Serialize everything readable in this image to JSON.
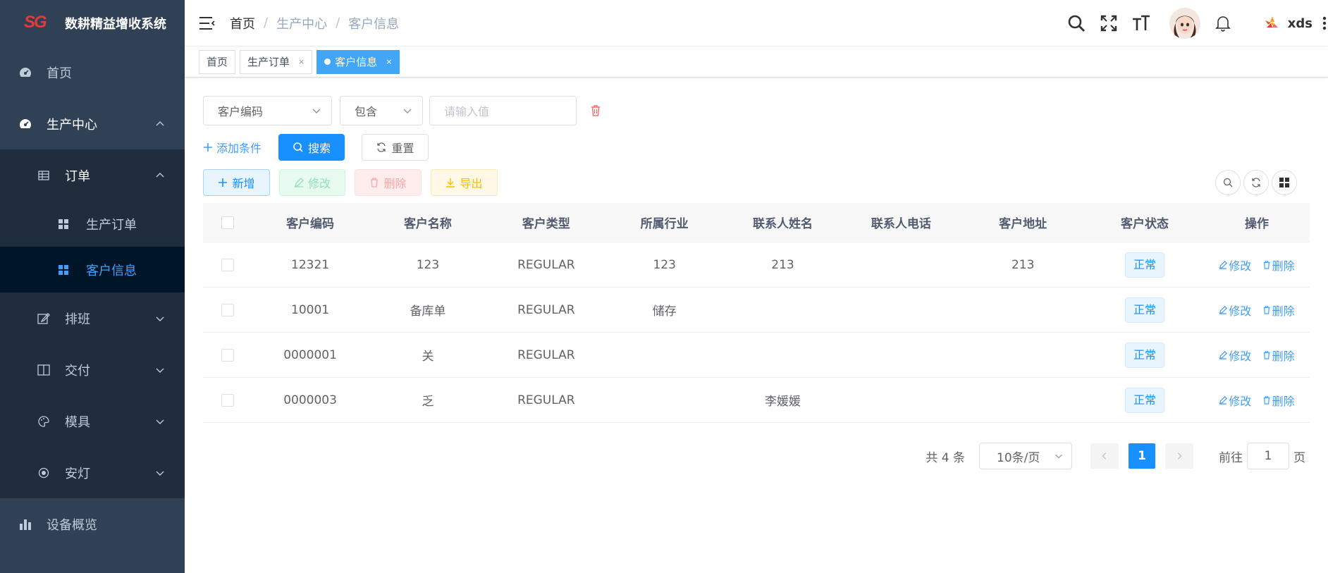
{
  "app": {
    "logo_text": "SG",
    "title": "数耕精益增收系统"
  },
  "sidebar": {
    "items": [
      {
        "label": "首页"
      },
      {
        "label": "生产中心"
      },
      {
        "label": "订单"
      },
      {
        "label": "生产订单"
      },
      {
        "label": "客户信息"
      },
      {
        "label": "排班"
      },
      {
        "label": "交付"
      },
      {
        "label": "模具"
      },
      {
        "label": "安灯"
      },
      {
        "label": "设备概览"
      }
    ]
  },
  "breadcrumb": [
    "首页",
    "生产中心",
    "客户信息"
  ],
  "user": {
    "name": "xds"
  },
  "tags": [
    {
      "label": "首页"
    },
    {
      "label": "生产订单",
      "close": "×"
    },
    {
      "label": "客户信息",
      "close": "×"
    }
  ],
  "filter": {
    "field": "客户编码",
    "operator": "包含",
    "value_placeholder": "请输入值",
    "add_condition": "添加条件",
    "search": "搜索",
    "reset": "重置"
  },
  "toolbar": {
    "add": "新增",
    "edit": "修改",
    "delete": "删除",
    "export": "导出"
  },
  "table": {
    "headers": [
      "客户编码",
      "客户名称",
      "客户类型",
      "所属行业",
      "联系人姓名",
      "联系人电话",
      "客户地址",
      "客户状态",
      "操作"
    ],
    "rows": [
      {
        "code": "12321",
        "name": "123",
        "type": "REGULAR",
        "industry": "123",
        "contact": "213",
        "phone": "",
        "address": "213",
        "status": "正常"
      },
      {
        "code": "10001",
        "name": "备库单",
        "type": "REGULAR",
        "industry": "储存",
        "contact": "",
        "phone": "",
        "address": "",
        "status": "正常"
      },
      {
        "code": "0000001",
        "name": "关",
        "type": "REGULAR",
        "industry": "",
        "contact": "",
        "phone": "",
        "address": "",
        "status": "正常"
      },
      {
        "code": "0000003",
        "name": "乏",
        "type": "REGULAR",
        "industry": "",
        "contact": "李媛媛",
        "phone": "",
        "address": "",
        "status": "正常"
      }
    ],
    "op_edit": "修改",
    "op_delete": "删除"
  },
  "pagination": {
    "total_text": "共 4 条",
    "page_size": "10条/页",
    "current_page": "1",
    "goto_label": "前往",
    "goto_value": "1",
    "page_unit": "页"
  },
  "colors": {
    "sidebar_bg": "#304156",
    "submenu_bg": "#1f2d3d",
    "active_menu_bg": "#001528",
    "primary": "#1890ff",
    "danger": "#f56c6c"
  }
}
